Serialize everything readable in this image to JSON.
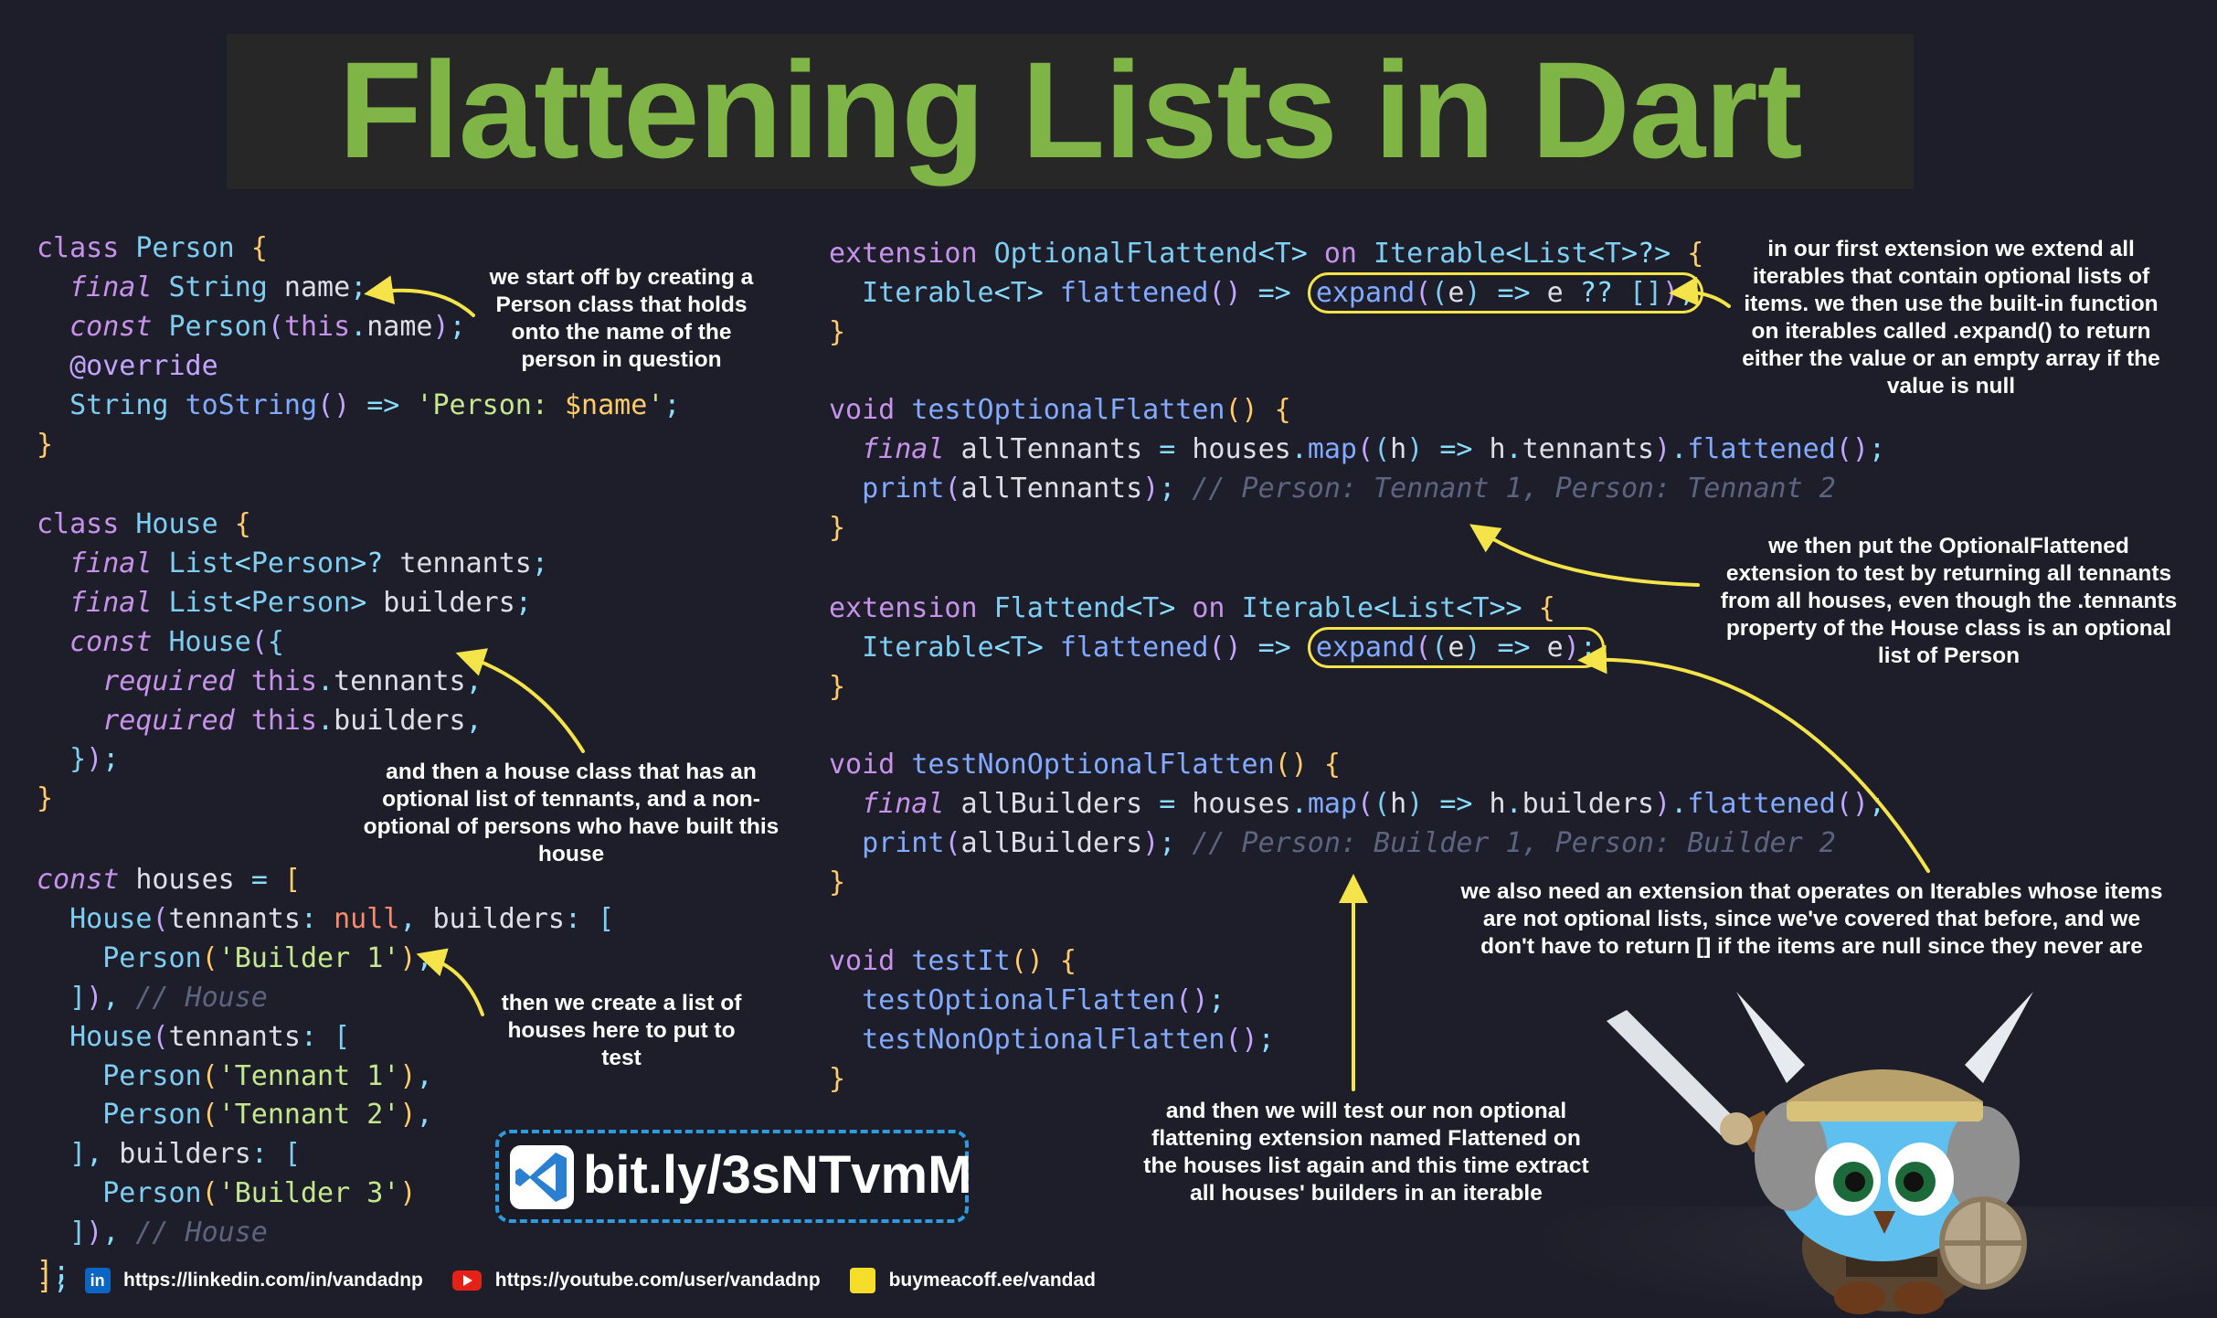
{
  "title": "Flattening Lists in Dart",
  "code_left": {
    "person_class": [
      "class Person {",
      "final String name;",
      "const Person(this.name);",
      "@override",
      "String toString() => 'Person: $name';",
      "}"
    ],
    "house_class": [
      "class House {",
      "final List<Person>? tennants;",
      "final List<Person> builders;",
      "const House({",
      "required this.tennants,",
      "required this.builders,",
      "});",
      "}"
    ],
    "houses_list": [
      "const houses = [",
      "House(tennants: null, builders: [",
      "Person('Builder 1'),",
      "]), // House",
      "House(tennants: [",
      "Person('Tennant 1'),",
      "Person('Tennant 2'),",
      "], builders: [",
      "Person('Builder 3')",
      "]), // House",
      "];"
    ]
  },
  "code_right": {
    "optional_extension": [
      "extension OptionalFlattend<T> on Iterable<List<T>?> {",
      "Iterable<T> flattened() => expand((e) => e ?? []);",
      "}"
    ],
    "test_optional": [
      "void testOptionalFlatten() {",
      "final allTennants = houses.map((h) => h.tennants).flattened();",
      "print(allTennants); // Person: Tennant 1, Person: Tennant 2",
      "}"
    ],
    "nonoptional_extension": [
      "extension Flattend<T> on Iterable<List<T>> {",
      "Iterable<T> flattened() => expand((e) => e);",
      "}"
    ],
    "test_nonoptional": [
      "void testNonOptionalFlatten() {",
      "final allBuilders = houses.map((h) => h.builders).flattened();",
      "print(allBuilders); // Person: Builder 1, Person: Builder 2",
      "}"
    ],
    "test_it": [
      "void testIt() {",
      "testOptionalFlatten();",
      "testNonOptionalFlatten();",
      "}"
    ]
  },
  "notes": {
    "person": [
      "we start off by creating a",
      "Person class that holds",
      "onto the name of the",
      "person in question"
    ],
    "house": [
      "and then a house class that has an",
      "optional list of tennants, and a non-",
      "optional of persons who have built this",
      "house"
    ],
    "houses": [
      "then we create a list of",
      "houses here to put to",
      "test"
    ],
    "first_extension": [
      "in our first extension we extend all",
      "iterables that contain optional lists of",
      "items. we then use the built-in function",
      "on iterables called .expand() to return",
      "either the value or an empty array if the",
      "value is null"
    ],
    "test_optional": [
      "we then put the OptionalFlattened",
      "extension to test by returning all tennants",
      "from all houses, even though the .tennants",
      "property of the House class is an optional",
      "list of Person"
    ],
    "second_extension": [
      "we also need an extension that operates on Iterables whose items",
      "are not optional lists, since we've covered that before, and we",
      "don't have to return [] if the items are null since they never are"
    ],
    "test_nonoptional": [
      "and then we will test our non optional",
      "flattening extension named Flattened on",
      "the houses list again and this time extract",
      "all houses' builders in an iterable"
    ]
  },
  "badge": {
    "text": "bit.ly/3sNTvmM",
    "icon": "vscode-icon"
  },
  "footer": {
    "linkedin": "https://linkedin.com/in/vandadnp",
    "youtube": "https://youtube.com/user/vandadnp",
    "coffee": "buymeacoff.ee/vandad"
  },
  "colors": {
    "title": "#7fb446",
    "highlight": "#f4e44a",
    "arrow": "#f4e44a",
    "background": "#1d1e29"
  }
}
